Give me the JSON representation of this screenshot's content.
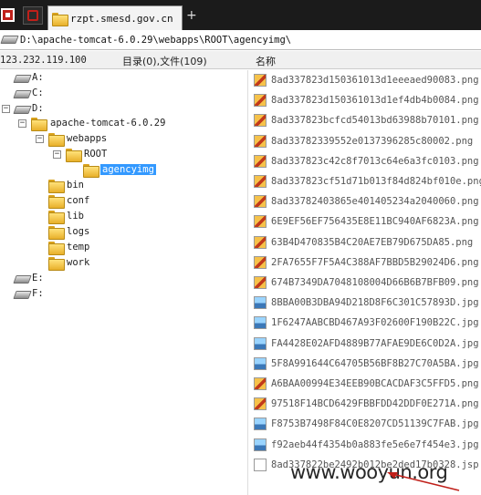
{
  "tabbar": {
    "tab_title": "rzpt.smesd.gov.cn",
    "add_label": "+"
  },
  "address": {
    "path": "D:\\apache-tomcat-6.0.29\\webapps\\ROOT\\agencyimg\\"
  },
  "info": {
    "ip": "123.232.119.100",
    "counts": "目录(0),文件(109)",
    "name_column": "名称"
  },
  "tree": {
    "drive_a": "A:",
    "drive_c": "C:",
    "drive_d": "D:",
    "tomcat": "apache-tomcat-6.0.29",
    "webapps": "webapps",
    "root": "ROOT",
    "agencyimg": "agencyimg",
    "bin": "bin",
    "conf": "conf",
    "lib": "lib",
    "logs": "logs",
    "temp": "temp",
    "work": "work",
    "drive_e": "E:",
    "drive_f": "F:",
    "expand_minus": "−"
  },
  "files": [
    {
      "name": "8ad337823d150361013d1eeeaed90083.png",
      "type": "png"
    },
    {
      "name": "8ad337823d150361013d1ef4db4b0084.png",
      "type": "png"
    },
    {
      "name": "8ad337823bcfcd54013bd63988b70101.png",
      "type": "png"
    },
    {
      "name": "8ad33782339552e0137396285c80002.png",
      "type": "png"
    },
    {
      "name": "8ad337823c42c8f7013c64e6a3fc0103.png",
      "type": "png"
    },
    {
      "name": "8ad337823cf51d71b013f84d824bf010e.png",
      "type": "png"
    },
    {
      "name": "8ad33782403865e401405234a2040060.png",
      "type": "png"
    },
    {
      "name": "6E9EF56EF756435E8E11BC940AF6823A.png",
      "type": "png"
    },
    {
      "name": "63B4D470835B4C20AE7EB79D675DA85.png",
      "type": "png"
    },
    {
      "name": "2FA7655F7F5A4C388AF7BBD5B29024D6.png",
      "type": "png"
    },
    {
      "name": "674B7349DA7048108004D66B6B7BFB09.png",
      "type": "png"
    },
    {
      "name": "8BBA00B3DBA94D218D8F6C301C57893D.jpg",
      "type": "jpg"
    },
    {
      "name": "1F6247AABCBD467A93F02600F190B22C.jpg",
      "type": "jpg"
    },
    {
      "name": "FA4428E02AFD4889B77AFAE9DE6C0D2A.jpg",
      "type": "jpg"
    },
    {
      "name": "5F8A991644C64705B56BF8B27C70A5BA.jpg",
      "type": "jpg"
    },
    {
      "name": "A6BAA00994E34EEB90BCACDAF3C5FFD5.png",
      "type": "png"
    },
    {
      "name": "97518F14BCD6429FBBFDD42DDF0E271A.png",
      "type": "png"
    },
    {
      "name": "F8753B7498F84C0E8207CD51139C7FAB.jpg",
      "type": "jpg"
    },
    {
      "name": "f92aeb44f4354b0a883fe5e6e7f454e3.jpg",
      "type": "jpg"
    },
    {
      "name": "8ad337822be2492b012be2ded17b0328.jsp",
      "type": "blank"
    }
  ],
  "watermark": "www.wooyun.org",
  "colors": {
    "selection": "#3399ff",
    "arrow": "#c0201a",
    "tabbar": "#1b1b1b"
  }
}
